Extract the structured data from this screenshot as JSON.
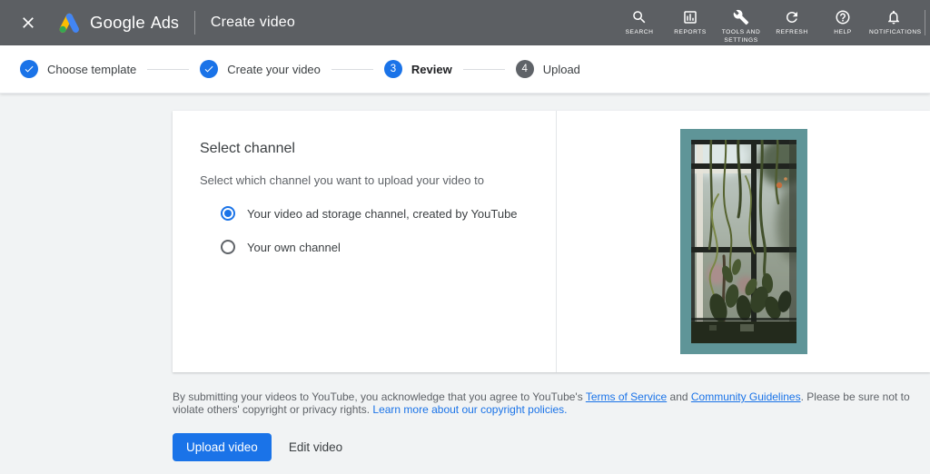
{
  "colors": {
    "accent_blue": "#1a73e8",
    "header_bg": "#5c5f63",
    "page_bg": "#f1f3f4",
    "preview_border_teal": "#5f9598",
    "step_inactive_gray": "#5f6368"
  },
  "header": {
    "brand_google": "Google",
    "brand_ads": "Ads",
    "page_title": "Create video",
    "actions": [
      {
        "icon": "search-icon",
        "label": "SEARCH"
      },
      {
        "icon": "reports-icon",
        "label": "REPORTS"
      },
      {
        "icon": "wrench-icon",
        "label": "TOOLS AND SETTINGS"
      },
      {
        "icon": "refresh-icon",
        "label": "REFRESH"
      },
      {
        "icon": "help-icon",
        "label": "HELP"
      },
      {
        "icon": "bell-icon",
        "label": "NOTIFICATIONS"
      }
    ]
  },
  "stepper": {
    "steps": [
      {
        "label": "Choose template",
        "status": "completed"
      },
      {
        "label": "Create your video",
        "status": "completed"
      },
      {
        "label": "Review",
        "number": "3",
        "status": "current"
      },
      {
        "label": "Upload",
        "number": "4",
        "status": "upcoming"
      }
    ]
  },
  "select_channel": {
    "title": "Select channel",
    "description": "Select which channel you want to upload your video to",
    "options": [
      {
        "label": "Your video ad storage channel, created by YouTube",
        "selected": true
      },
      {
        "label": "Your own channel",
        "selected": false
      }
    ]
  },
  "legal": {
    "text_before_tos": "By submitting your videos to YouTube, you acknowledge that you agree to YouTube's ",
    "tos_link": "Terms of Service",
    "text_between": " and ",
    "guidelines_link": "Community Guidelines",
    "text_after": ". Please be sure not to violate others' copyright or privacy rights. ",
    "copyright_link": "Learn more about our copyright policies."
  },
  "actions_bar": {
    "upload_button": "Upload video",
    "edit_button": "Edit video"
  }
}
